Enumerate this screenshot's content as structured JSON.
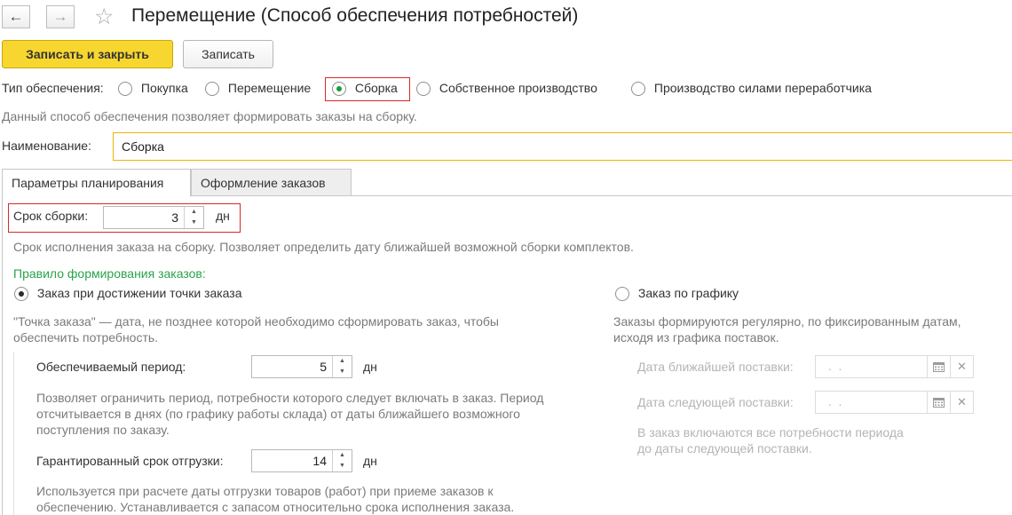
{
  "window": {
    "title": "Перемещение (Способ обеспечения потребностей)"
  },
  "nav": {
    "back_glyph": "←",
    "forward_glyph": "→",
    "star_glyph": "☆"
  },
  "toolbar": {
    "save_close_label": "Записать и закрыть",
    "save_label": "Записать"
  },
  "supply_type": {
    "label": "Тип обеспечения:",
    "options": [
      "Покупка",
      "Перемещение",
      "Сборка",
      "Собственное производство",
      "Производство силами переработчика"
    ],
    "selected": "Сборка",
    "hint": "Данный способ обеспечения позволяет формировать заказы на сборку."
  },
  "name": {
    "label": "Наименование:",
    "value": "Сборка"
  },
  "tabs": [
    {
      "label": "Параметры планирования"
    },
    {
      "label": "Оформление заказов"
    }
  ],
  "assembly": {
    "label": "Срок сборки:",
    "value": "3",
    "unit": "дн",
    "hint": "Срок исполнения заказа на сборку. Позволяет определить дату ближайшей возможной сборки комплектов."
  },
  "order_rule": {
    "label": "Правило формирования заказов:",
    "option_point": "Заказ при достижении точки заказа",
    "option_schedule": "Заказ по графику",
    "point_hint_1": "\"Точка заказа\" — дата, не позднее которой необходимо сформировать заказ, чтобы",
    "point_hint_2": "обеспечить потребность.",
    "schedule_hint_1": "Заказы формируются регулярно, по фиксированным датам,",
    "schedule_hint_2": "исходя из графика поставок."
  },
  "period": {
    "label": "Обеспечиваемый период:",
    "value": "5",
    "unit": "дн",
    "hint_1": "Позволяет ограничить период, потребности которого следует включать в заказ. Период",
    "hint_2": "отсчитывается в днях (по графику работы склада) от даты ближайшего возможного",
    "hint_3": "поступления по заказу."
  },
  "shipment": {
    "label": "Гарантированный срок отгрузки:",
    "value": "14",
    "unit": "дн",
    "hint_1": "Используется при расчете даты отгрузки товаров (работ) при приеме заказов к",
    "hint_2": "обеспечению. Устанавливается с запасом относительно срока исполнения заказа."
  },
  "schedule": {
    "next_delivery_label": "Дата ближайшей поставки:",
    "following_delivery_label": "Дата следующей поставки:",
    "date_placeholder": " .  .",
    "hint_1": "В заказ включаются все потребности периода",
    "hint_2": "до даты следующей поставки."
  },
  "icons": {
    "calendar": "calendar-icon",
    "clear": "clear-icon",
    "spin_up": "▲",
    "spin_down": "▼",
    "clear_glyph": "✕"
  },
  "colors": {
    "accent_yellow": "#f7d630",
    "highlight_red": "#d62a2a",
    "green_label": "#2aa34a",
    "name_field_border": "#f0b400"
  }
}
